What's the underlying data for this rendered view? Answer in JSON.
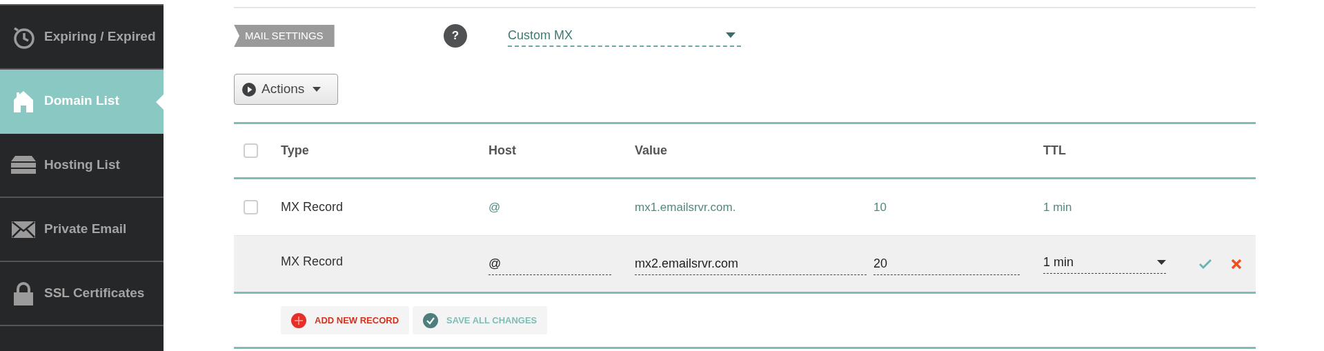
{
  "sidebar": {
    "items": [
      {
        "label": "Expiring / Expired",
        "selected": false
      },
      {
        "label": "Domain List",
        "selected": true
      },
      {
        "label": "Hosting List",
        "selected": false
      },
      {
        "label": "Private Email",
        "selected": false
      },
      {
        "label": "SSL Certificates",
        "selected": false
      }
    ]
  },
  "mail_settings": {
    "label": "MAIL SETTINGS",
    "help": "?",
    "value": "Custom MX"
  },
  "actions_button": {
    "label": "Actions"
  },
  "table": {
    "select_all_checked": false,
    "columns": [
      {
        "label": "Type"
      },
      {
        "label": "Host"
      },
      {
        "label": "Value"
      },
      {
        "label": "TTL"
      }
    ],
    "rows": [
      {
        "kind": "view",
        "checked": false,
        "type": "MX Record",
        "host": "@",
        "value": "mx1.emailsrvr.com.",
        "priority": "10",
        "ttl": "1 min"
      },
      {
        "kind": "edit",
        "type": "MX Record",
        "host": "@",
        "value": "mx2.emailsrvr.com",
        "priority": "20",
        "ttl": "1 min"
      }
    ]
  },
  "footer_buttons": [
    {
      "kind": "add",
      "label": "ADD NEW RECORD"
    },
    {
      "kind": "save",
      "label": "SAVE ALL CHANGES"
    }
  ]
}
